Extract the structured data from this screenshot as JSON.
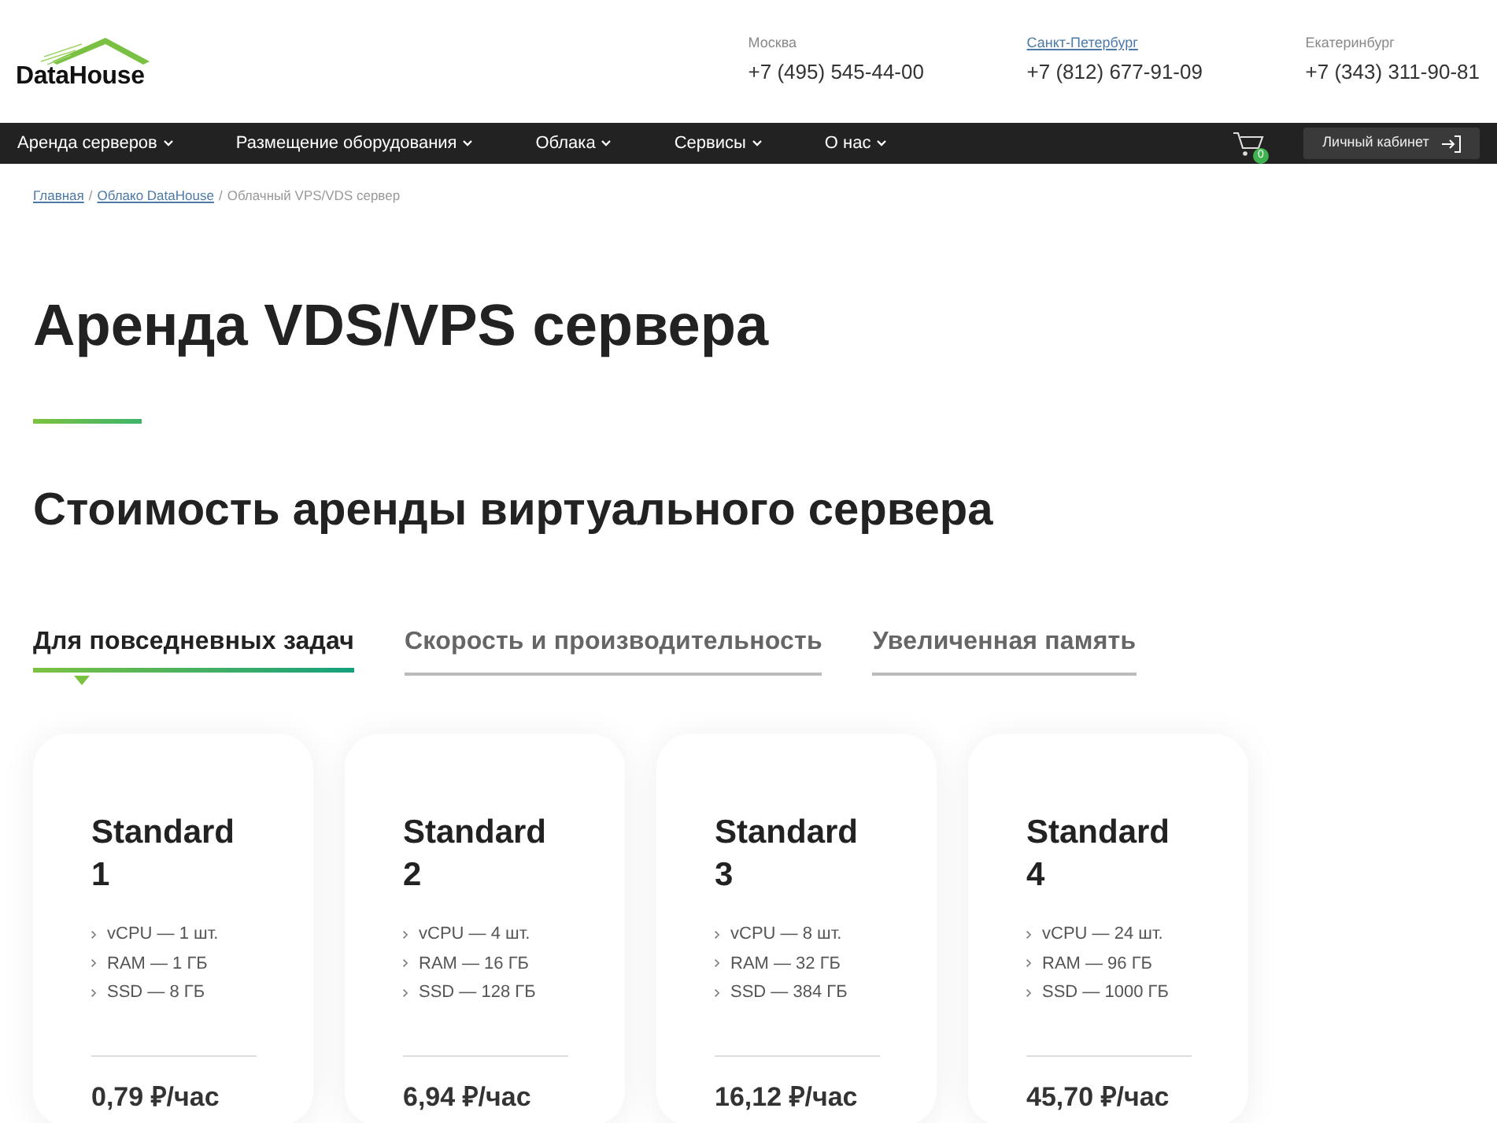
{
  "header": {
    "logo": "DataHouse",
    "contacts": [
      {
        "city": "Москва",
        "link": false,
        "phone": "+7 (495) 545-44-00"
      },
      {
        "city": "Санкт-Петербург",
        "link": true,
        "phone": "+7 (812) 677-91-09"
      },
      {
        "city": "Екатеринбург",
        "link": false,
        "phone": "+7 (343) 311-90-81"
      }
    ]
  },
  "nav": {
    "items": [
      {
        "label": "Аренда серверов"
      },
      {
        "label": "Размещение оборудования"
      },
      {
        "label": "Облака"
      },
      {
        "label": "Сервисы"
      },
      {
        "label": "О нас"
      }
    ],
    "cart_count": "0",
    "account_button": "Личный кабинет"
  },
  "breadcrumbs": [
    {
      "label": "Главная",
      "kind": "link"
    },
    {
      "separator": "/",
      "label": "Облако DataHouse",
      "kind": "link"
    },
    {
      "separator": "/",
      "label": "Облачный VPS/VDS сервер",
      "kind": "current"
    }
  ],
  "title": "Аренда VDS/VPS сервера",
  "subtitle": "Стоимость аренды виртуального сервера",
  "tabs": [
    {
      "label": "Для повседневных задач",
      "selected": true
    },
    {
      "label": "Скорость и производительность",
      "selected": false
    },
    {
      "label": "Увеличенная память",
      "selected": false
    }
  ],
  "plans": [
    {
      "name": "Standard 1",
      "specs": [
        "vCPU — 1 шт.",
        "RAM — 1 ГБ",
        "SSD — 8 ГБ"
      ],
      "price": "0,79 ₽/час"
    },
    {
      "name": "Standard 2",
      "specs": [
        "vCPU — 4 шт.",
        "RAM — 16 ГБ",
        "SSD — 128 ГБ"
      ],
      "price": "6,94 ₽/час"
    },
    {
      "name": "Standard 3",
      "specs": [
        "vCPU — 8 шт.",
        "RAM — 32 ГБ",
        "SSD — 384 ГБ"
      ],
      "price": "16,12 ₽/час"
    },
    {
      "name": "Standard 4",
      "specs": [
        "vCPU — 24 шт.",
        "RAM — 96 ГБ",
        "SSD — 1000 ГБ"
      ],
      "price": "45,70 ₽/час"
    }
  ]
}
